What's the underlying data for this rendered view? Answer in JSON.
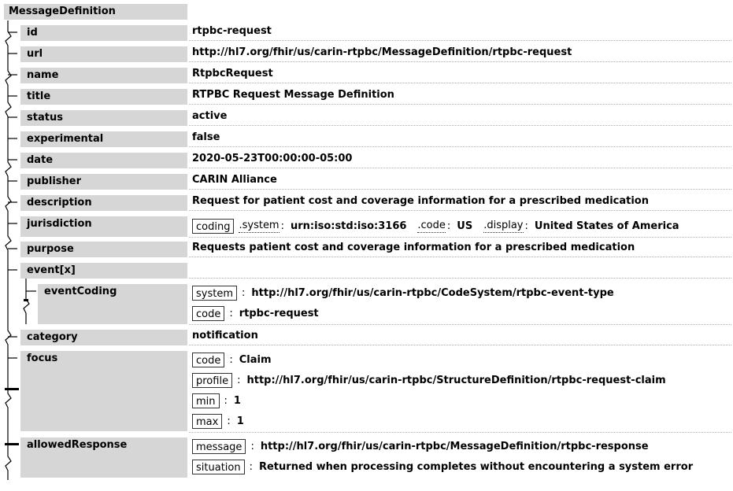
{
  "resource": "MessageDefinition",
  "fields": {
    "id": {
      "label": "id",
      "value": "rtpbc-request"
    },
    "url": {
      "label": "url",
      "value": "http://hl7.org/fhir/us/carin-rtpbc/MessageDefinition/rtpbc-request"
    },
    "name": {
      "label": "name",
      "value": "RtpbcRequest"
    },
    "title": {
      "label": "title",
      "value": "RTPBC Request Message Definition"
    },
    "status": {
      "label": "status",
      "value": "active"
    },
    "experimental": {
      "label": "experimental",
      "value": "false"
    },
    "date": {
      "label": "date",
      "value": "2020-05-23T00:00:00-05:00"
    },
    "publisher": {
      "label": "publisher",
      "value": "CARIN Alliance"
    },
    "description": {
      "label": "description",
      "value": "Request for patient cost and coverage information for a prescribed medication"
    },
    "jurisdiction": {
      "label": "jurisdiction",
      "coding_label": "coding",
      "system_label": ".system",
      "system_value": "urn:iso:std:iso:3166",
      "code_label": ".code",
      "code_value": "US",
      "display_label": ".display",
      "display_value": "United States of America"
    },
    "purpose": {
      "label": "purpose",
      "value": "Requests patient cost and coverage information for a prescribed medication"
    },
    "event": {
      "label": "event[x]",
      "coding_label": "eventCoding",
      "system_label": "system",
      "system_value": "http://hl7.org/fhir/us/carin-rtpbc/CodeSystem/rtpbc-event-type",
      "code_label": "code",
      "code_value": "rtpbc-request"
    },
    "category": {
      "label": "category",
      "value": "notification"
    },
    "focus": {
      "label": "focus",
      "code_label": "code",
      "code_value": "Claim",
      "profile_label": "profile",
      "profile_value": "http://hl7.org/fhir/us/carin-rtpbc/StructureDefinition/rtpbc-request-claim",
      "min_label": "min",
      "min_value": "1",
      "max_label": "max",
      "max_value": "1"
    },
    "allowedResponse": {
      "label": "allowedResponse",
      "message_label": "message",
      "message_value": "http://hl7.org/fhir/us/carin-rtpbc/MessageDefinition/rtpbc-response",
      "situation_label": "situation",
      "situation_value": "Returned when processing completes without encountering a system error"
    }
  }
}
